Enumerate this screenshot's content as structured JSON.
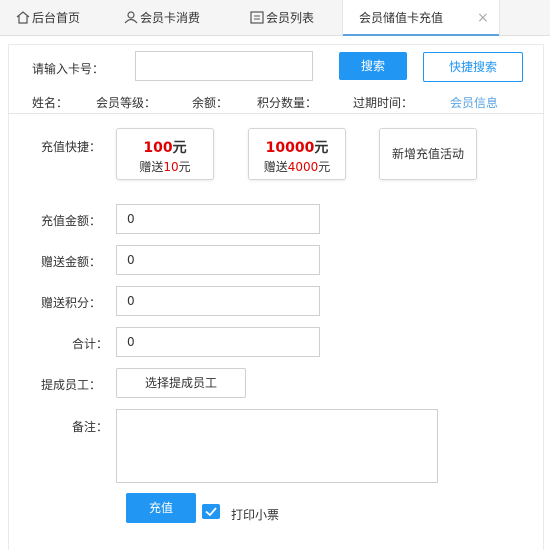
{
  "tabs": [
    {
      "label": "后台首页",
      "icon": "home-icon"
    },
    {
      "label": "会员卡消费",
      "icon": "user-icon"
    },
    {
      "label": "会员列表",
      "icon": "list-icon"
    },
    {
      "label": "会员储值卡充值",
      "icon": "",
      "active": true,
      "close": "×"
    }
  ],
  "search": {
    "card_label": "请输入卡号：",
    "card_value": "",
    "search_button": "搜索",
    "quick_search_button": "快捷搜索"
  },
  "member_info": {
    "name_label": "姓名：",
    "level_label": "会员等级：",
    "balance_label": "余额：",
    "points_label": "积分数量：",
    "expire_label": "过期时间：",
    "info_link": "会员信息"
  },
  "quick_recharge": {
    "label": "充值快捷：",
    "options": [
      {
        "amount": "100",
        "unit": "元",
        "bonus_prefix": "赠送",
        "bonus": "10",
        "bonus_unit": "元"
      },
      {
        "amount": "10000",
        "unit": "元",
        "bonus_prefix": "赠送",
        "bonus": "4000",
        "bonus_unit": "元"
      }
    ],
    "new_activity": "新增充值活动"
  },
  "form": {
    "recharge_amount_label": "充值金额：",
    "recharge_amount_value": "0",
    "bonus_amount_label": "赠送金额：",
    "bonus_amount_value": "0",
    "bonus_points_label": "赠送积分：",
    "bonus_points_value": "0",
    "total_label": "合计：",
    "total_value": "0",
    "staff_label": "提成员工：",
    "staff_button": "选择提成员工",
    "remark_label": "备注：",
    "remark_value": ""
  },
  "actions": {
    "submit_button": "充值",
    "print_checked": true,
    "print_label": "打印小票"
  },
  "colors": {
    "primary": "#2196f3",
    "accent_red": "#e00000",
    "link": "#5aa3e0"
  }
}
